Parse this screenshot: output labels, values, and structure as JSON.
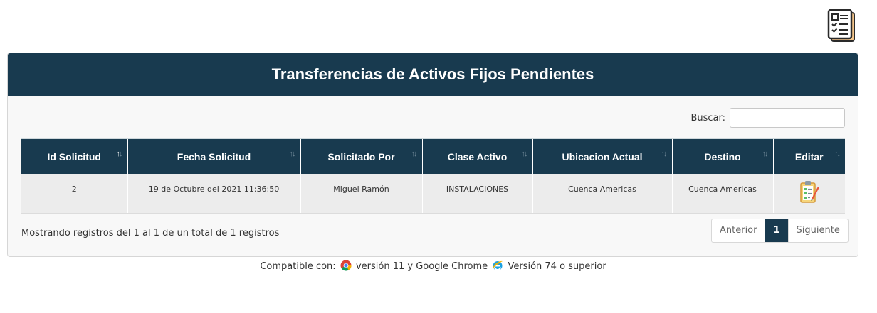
{
  "header": {
    "title": "Transferencias de Activos Fijos Pendientes"
  },
  "top_icon": "report-list-icon",
  "search": {
    "label": "Buscar:",
    "value": "",
    "placeholder": ""
  },
  "table": {
    "columns": [
      {
        "label": "Id Solicitud",
        "sorted": "asc"
      },
      {
        "label": "Fecha Solicitud",
        "sorted": "none"
      },
      {
        "label": "Solicitado Por",
        "sorted": "none"
      },
      {
        "label": "Clase Activo",
        "sorted": "none"
      },
      {
        "label": "Ubicacion Actual",
        "sorted": "none"
      },
      {
        "label": "Destino",
        "sorted": "none"
      },
      {
        "label": "Editar",
        "sorted": "none"
      }
    ],
    "rows": [
      {
        "id": "2",
        "fecha": "19 de Octubre del 2021 11:36:50",
        "solicitado_por": "Miguel Ramón",
        "clase": "INSTALACIONES",
        "ubicacion": "Cuenca Americas",
        "destino": "Cuenca Americas",
        "edit_icon": "clipboard-edit-icon"
      }
    ]
  },
  "info": "Mostrando registros del 1 al 1 de un total de 1 registros",
  "pagination": {
    "prev": "Anterior",
    "current": "1",
    "next": "Siguiente"
  },
  "footer": {
    "prefix": "Compatible con:",
    "chrome_text": "versión 11 y Google Chrome",
    "ie_text": "Versión 74 o superior"
  },
  "colors": {
    "primary": "#183a4f",
    "row_bg": "#ececec",
    "panel_bg": "#f8f8f8"
  }
}
